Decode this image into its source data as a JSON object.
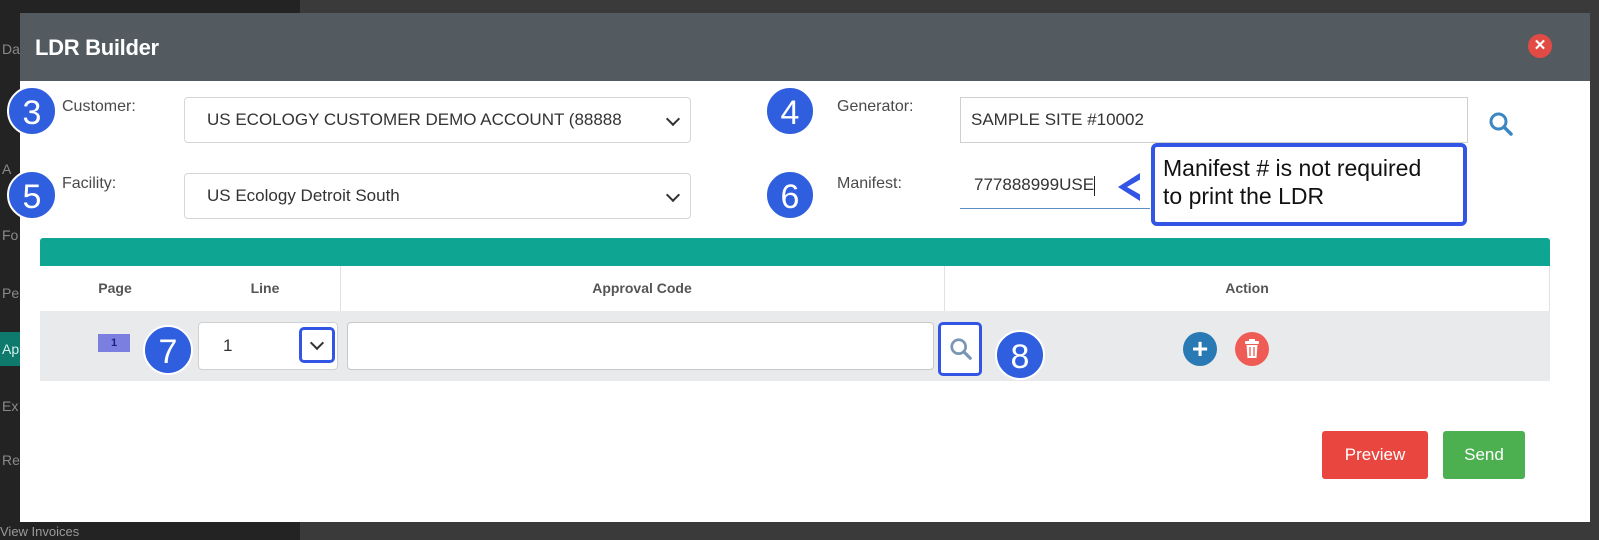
{
  "background": {
    "sidebar_items": [
      "Da",
      "A",
      "Fo",
      "Pe",
      "Ap",
      "Ex",
      "Re"
    ],
    "bottom_text": "View Invoices"
  },
  "modal": {
    "title": "LDR Builder",
    "close_icon": "close-circle-icon"
  },
  "form": {
    "customer": {
      "label": "Customer:",
      "value": "US ECOLOGY CUSTOMER DEMO ACCOUNT (88888"
    },
    "facility": {
      "label": "Facility:",
      "value": "US Ecology Detroit South"
    },
    "generator": {
      "label": "Generator:",
      "value": "SAMPLE SITE #10002"
    },
    "manifest": {
      "label": "Manifest:",
      "value": "777888999USE"
    }
  },
  "annotations": {
    "badges": [
      "3",
      "4",
      "5",
      "6",
      "7",
      "8"
    ],
    "callout_line1": "Manifest # is not required",
    "callout_line2": "to print the LDR",
    "highlight_color": "#3355e6"
  },
  "table": {
    "headers": {
      "page": "Page",
      "line": "Line",
      "approval_code": "Approval Code",
      "action": "Action"
    },
    "rows": [
      {
        "page": "1",
        "line": "1",
        "approval_code": ""
      }
    ]
  },
  "buttons": {
    "preview": "Preview",
    "send": "Send"
  },
  "colors": {
    "header": "#535b61",
    "teal": "#0ea593",
    "preview": "#e8463f",
    "send": "#4caf50",
    "add": "#2979b5",
    "delete": "#ef5b55"
  }
}
